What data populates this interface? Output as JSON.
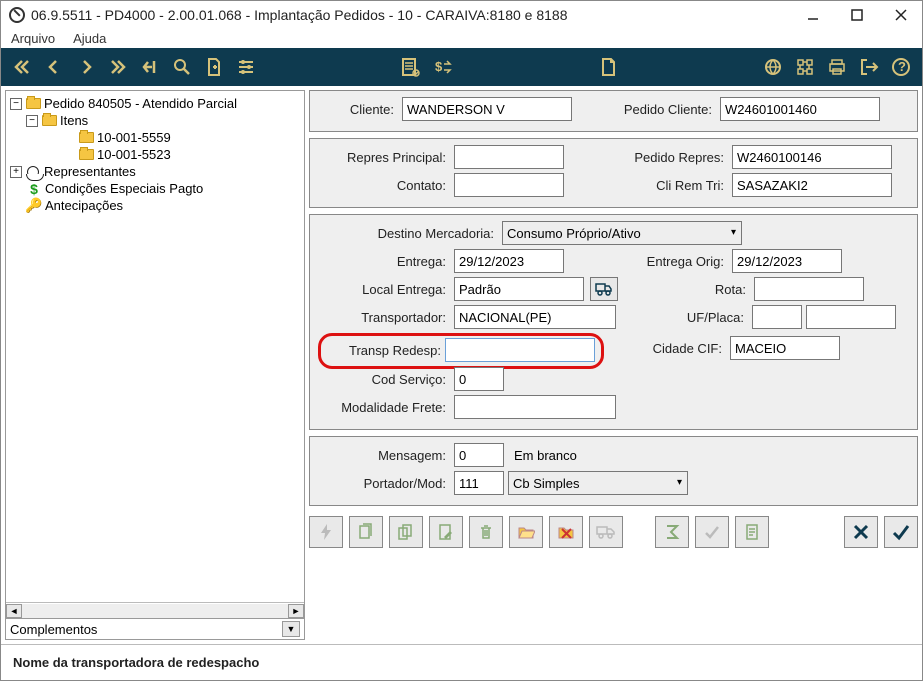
{
  "window": {
    "title": "06.9.5511 - PD4000 - 2.00.01.068 - Implantação Pedidos - 10 - CARAIVA:8180 e 8188"
  },
  "menu": {
    "arquivo": "Arquivo",
    "ajuda": "Ajuda"
  },
  "tree": {
    "pedido": "Pedido 840505 - Atendido Parcial",
    "itens": "Itens",
    "item1": "10-001-5559",
    "item2": "10-001-5523",
    "representantes": "Representantes",
    "cond": "Condições Especiais Pagto",
    "antec": "Antecipações"
  },
  "complementos_label": "Complementos",
  "form": {
    "cliente_label": "Cliente:",
    "cliente_value": "WANDERSON V",
    "pedido_cliente_label": "Pedido Cliente:",
    "pedido_cliente_value": "W24601001460",
    "repres_principal_label": "Repres Principal:",
    "repres_principal_value": "",
    "pedido_repres_label": "Pedido Repres:",
    "pedido_repres_value": "W2460100146",
    "contato_label": "Contato:",
    "contato_value": "",
    "cli_rem_tri_label": "Cli Rem Tri:",
    "cli_rem_tri_value": "SASAZAKI2",
    "destino_label": "Destino Mercadoria:",
    "destino_value": "Consumo Próprio/Ativo",
    "entrega_label": "Entrega:",
    "entrega_value": "29/12/2023",
    "entrega_orig_label": "Entrega Orig:",
    "entrega_orig_value": "29/12/2023",
    "local_entrega_label": "Local Entrega:",
    "local_entrega_value": "Padrão",
    "rota_label": "Rota:",
    "rota_value": "",
    "transportador_label": "Transportador:",
    "transportador_value": "NACIONAL(PE)",
    "uf_placa_label": "UF/Placa:",
    "uf_value": "",
    "placa_value": "",
    "transp_redesp_label": "Transp Redesp:",
    "transp_redesp_value": "",
    "cidade_cif_label": "Cidade CIF:",
    "cidade_cif_value": "MACEIO",
    "cod_servico_label": "Cod Serviço:",
    "cod_servico_value": "0",
    "modalidade_frete_label": "Modalidade Frete:",
    "modalidade_frete_value": "",
    "mensagem_label": "Mensagem:",
    "mensagem_value": "0",
    "mensagem_desc": "Em branco",
    "portador_label": "Portador/Mod:",
    "portador_value": "111",
    "portador_mod_value": "Cb Simples"
  },
  "status": "Nome da transportadora de redespacho"
}
